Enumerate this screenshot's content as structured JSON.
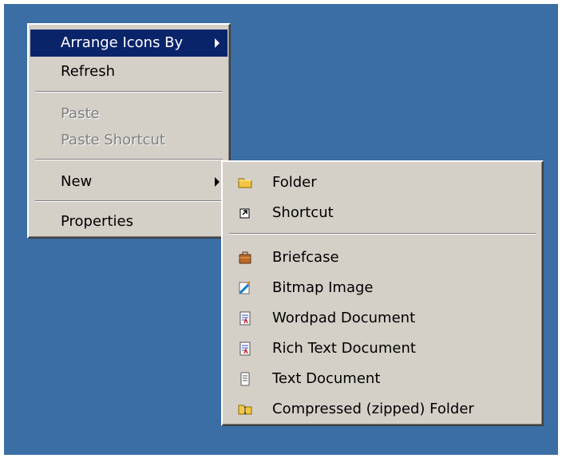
{
  "main_menu": {
    "items": [
      {
        "label": "Arrange Icons By",
        "icon": "submenu-arrow-icon"
      },
      {
        "label": "Refresh",
        "icon": ""
      },
      {
        "label": "Paste",
        "icon": ""
      },
      {
        "label": "Paste Shortcut",
        "icon": ""
      },
      {
        "label": "New",
        "icon": "submenu-arrow-icon"
      },
      {
        "label": "Properties",
        "icon": ""
      }
    ]
  },
  "new_submenu": {
    "items": [
      {
        "label": "Folder",
        "icon": "folder-icon"
      },
      {
        "label": "Shortcut",
        "icon": "shortcut-icon"
      },
      {
        "label": "Briefcase",
        "icon": "briefcase-icon"
      },
      {
        "label": "Bitmap Image",
        "icon": "bitmap-image-icon"
      },
      {
        "label": "Wordpad Document",
        "icon": "wordpad-document-icon"
      },
      {
        "label": "Rich Text Document",
        "icon": "rich-text-document-icon"
      },
      {
        "label": "Text Document",
        "icon": "text-document-icon"
      },
      {
        "label": "Compressed (zipped) Folder",
        "icon": "compressed-folder-icon"
      }
    ]
  },
  "colors": {
    "desktop": "#3a6ea5",
    "menu_background": "#d4d0c8",
    "highlight": "#0a246a",
    "disabled_text": "#808080"
  }
}
